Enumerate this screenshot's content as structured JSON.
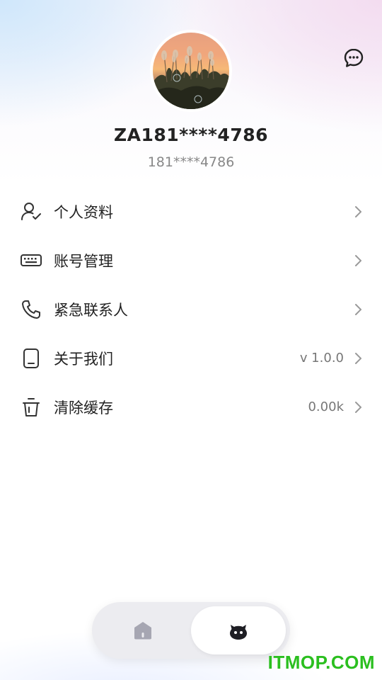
{
  "header": {
    "username": "ZA181****4786",
    "phone": "181****4786",
    "avatar_icon": "avatar-photo",
    "message_icon": "chat-bubble-icon"
  },
  "menu": {
    "items": [
      {
        "label": "个人资料",
        "value": "",
        "icon": "user-check-icon"
      },
      {
        "label": "账号管理",
        "value": "",
        "icon": "keyboard-icon"
      },
      {
        "label": "紧急联系人",
        "value": "",
        "icon": "phone-icon"
      },
      {
        "label": "关于我们",
        "value": "v 1.0.0",
        "icon": "device-icon"
      },
      {
        "label": "清除缓存",
        "value": "0.00k",
        "icon": "trash-icon"
      }
    ]
  },
  "tabbar": {
    "tabs": [
      {
        "icon": "home-icon",
        "active": false
      },
      {
        "icon": "profile-face-icon",
        "active": true
      }
    ]
  },
  "watermark": "ITMOP.COM",
  "colors": {
    "text_primary": "#222222",
    "text_secondary": "#888888",
    "tab_bg": "#ececf0",
    "watermark": "#2bbf1f"
  }
}
